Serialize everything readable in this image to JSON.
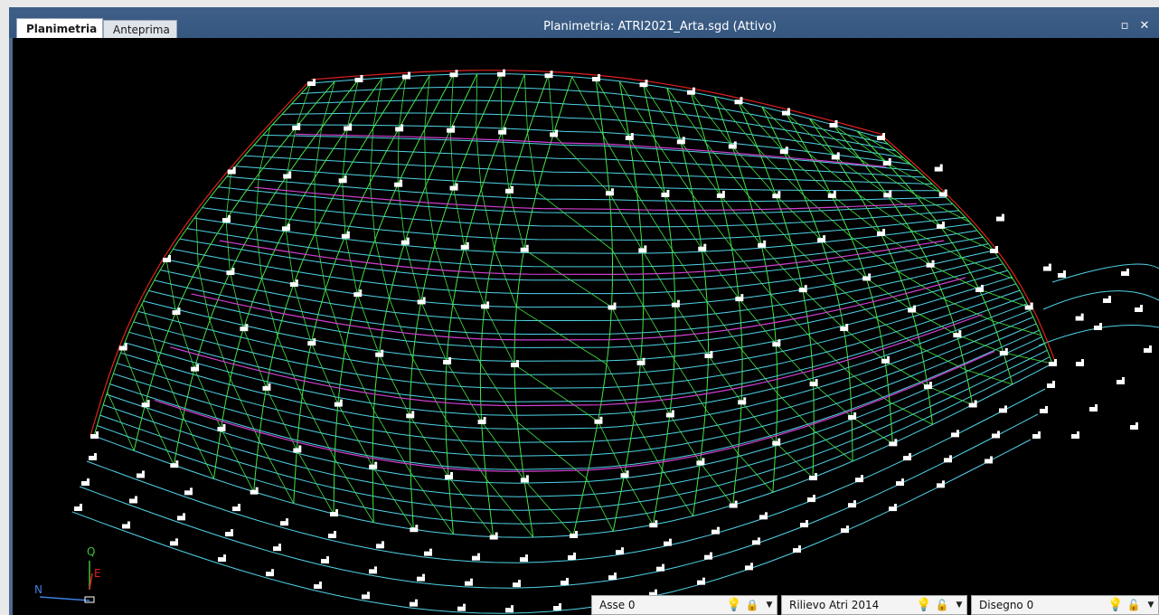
{
  "tabs": [
    {
      "label": "Planimetria",
      "active": true
    },
    {
      "label": "Anteprima",
      "active": false
    }
  ],
  "window": {
    "title": "Planimetria: ATRI2021_Arta.sgd (Attivo)",
    "restore_icon": "restore-icon",
    "close_icon": "close-icon"
  },
  "axes": {
    "q": "Q",
    "e": "E",
    "n": "N"
  },
  "colors": {
    "background": "#000000",
    "mesh": "#42e642",
    "contour": "#4fd3e8",
    "break_line": "#e02020",
    "section": "#d13fd1",
    "points": "#ffffff"
  },
  "statusbar": [
    {
      "label": "Asse 0",
      "visible_icon": "bulb-icon",
      "lock_icon": "lock-closed-icon"
    },
    {
      "label": "Rilievo Atri 2014",
      "visible_icon": "bulb-icon",
      "lock_icon": "lock-open-icon"
    },
    {
      "label": "Disegno 0",
      "visible_icon": "bulb-icon",
      "lock_icon": "lock-open-icon"
    }
  ]
}
